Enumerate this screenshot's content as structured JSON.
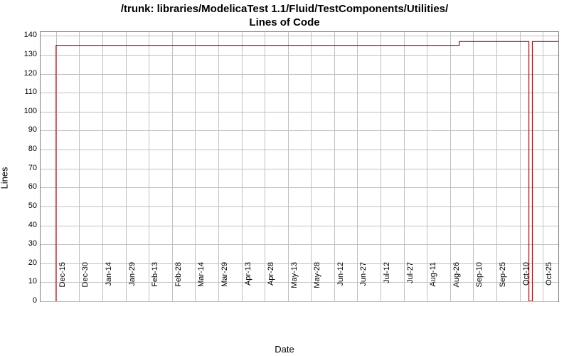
{
  "chart_data": {
    "type": "line",
    "title_line1": "/trunk: libraries/ModelicaTest 1.1/Fluid/TestComponents/Utilities/",
    "title_line2": "Lines of Code",
    "xlabel": "Date",
    "ylabel": "Lines",
    "ylim": [
      0,
      142
    ],
    "y_ticks": [
      0,
      10,
      20,
      30,
      40,
      50,
      60,
      70,
      80,
      90,
      100,
      110,
      120,
      130,
      140
    ],
    "x_categories": [
      "15-Dec",
      "30-Dec",
      "14-Jan",
      "29-Jan",
      "13-Feb",
      "28-Feb",
      "14-Mar",
      "29-Mar",
      "13-Apr",
      "28-Apr",
      "13-May",
      "28-May",
      "12-Jun",
      "27-Jun",
      "12-Jul",
      "27-Jul",
      "11-Aug",
      "26-Aug",
      "10-Sep",
      "25-Sep",
      "10-Oct",
      "25-Oct"
    ],
    "series": [
      {
        "name": "Lines of Code",
        "color": "#cc0000",
        "points": [
          {
            "x_index": 0.0,
            "y": 0
          },
          {
            "x_index": 0.0,
            "y": 135
          },
          {
            "x_index": 17.4,
            "y": 135
          },
          {
            "x_index": 17.4,
            "y": 137
          },
          {
            "x_index": 20.4,
            "y": 137
          },
          {
            "x_index": 20.4,
            "y": 0
          },
          {
            "x_index": 20.55,
            "y": 0
          },
          {
            "x_index": 20.55,
            "y": 137
          },
          {
            "x_index": 21.8,
            "y": 137
          },
          {
            "x_index": 21.8,
            "y": 0
          }
        ]
      }
    ]
  }
}
